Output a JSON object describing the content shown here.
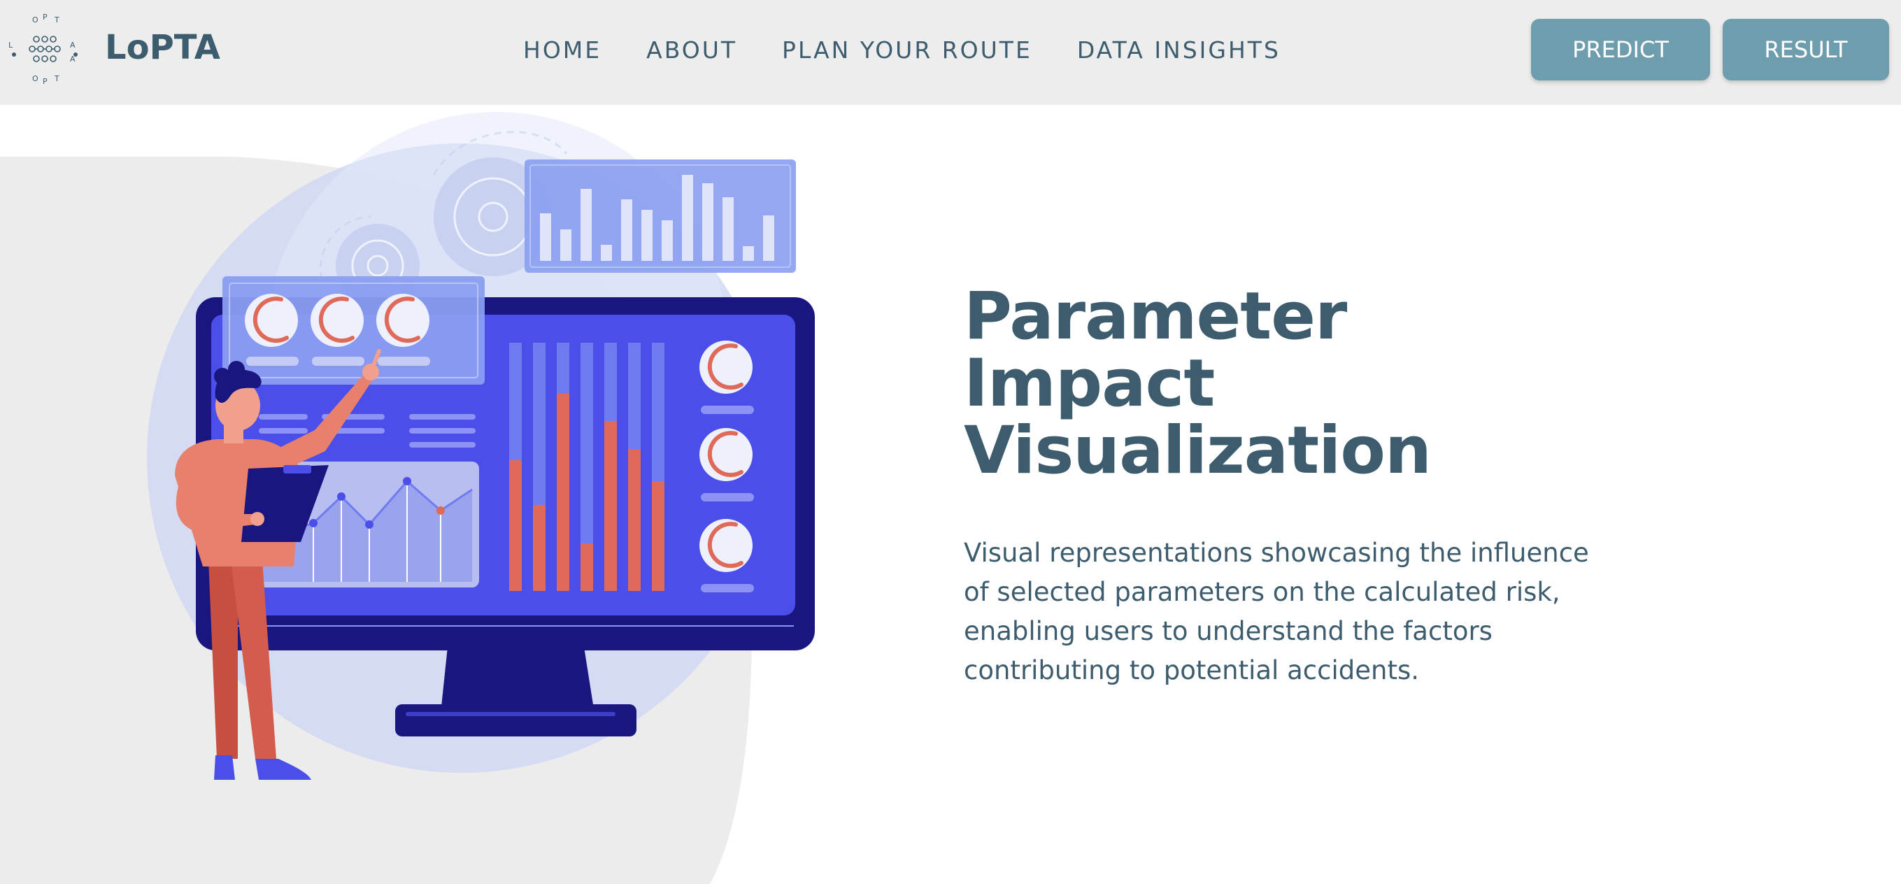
{
  "brand": {
    "name": "LoPTA",
    "logo_letters": [
      "L",
      "O",
      "P",
      "T",
      "A",
      "O",
      "P",
      "T",
      "A"
    ]
  },
  "nav": {
    "links": [
      {
        "label": "HOME"
      },
      {
        "label": "ABOUT"
      },
      {
        "label": "PLAN YOUR ROUTE"
      },
      {
        "label": "DATA INSIGHTS"
      }
    ],
    "predict_label": "PREDICT",
    "result_label": "RESULT"
  },
  "hero": {
    "title": "Parameter Impact Visualization",
    "description": "Visual representations showcasing the influence of selected parameters on the calculated risk, enabling users to understand the factors contributing to potential accidents."
  },
  "colors": {
    "text": "#3d5d6e",
    "button": "#6e9dae",
    "navbar": "#ededed",
    "monitor": "#4b4ee8",
    "accent": "#e06a5a"
  },
  "icons": {
    "logo": "lopta-logo-icon",
    "illustration": "dashboard-illustration"
  }
}
